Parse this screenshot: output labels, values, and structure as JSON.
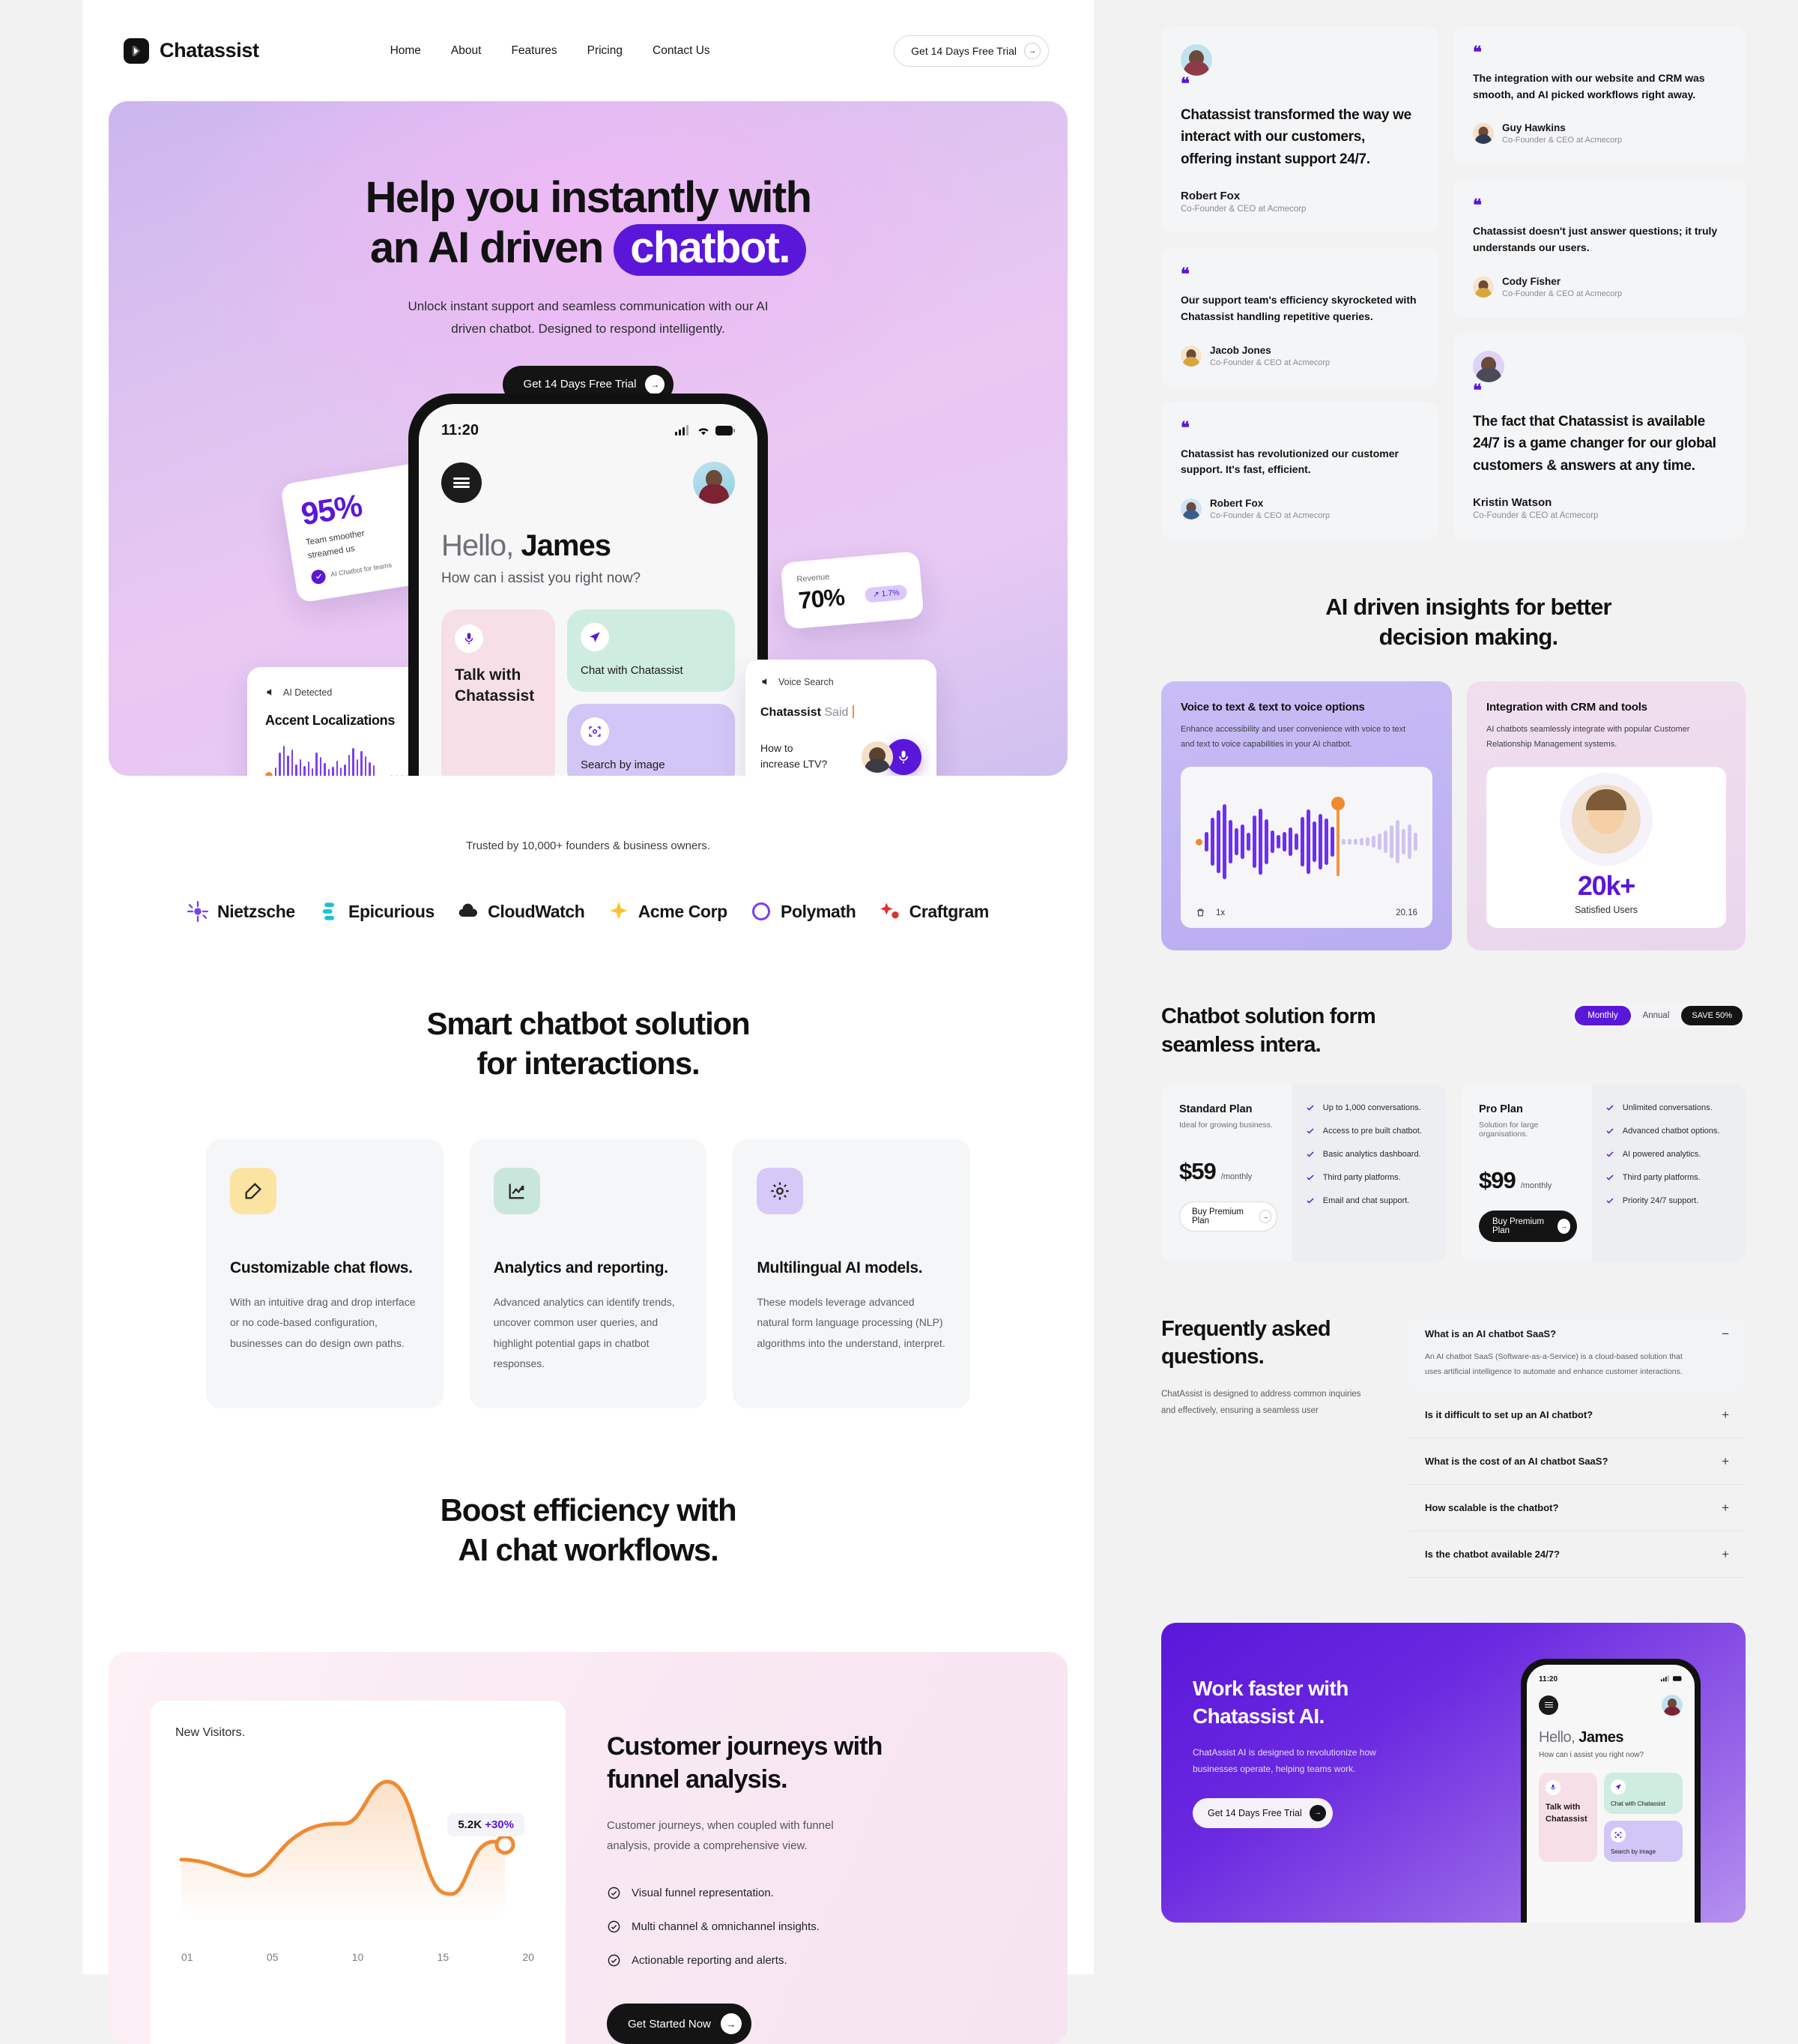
{
  "nav": {
    "brand": "Chatassist",
    "links": [
      "Home",
      "About",
      "Features",
      "Pricing",
      "Contact Us"
    ],
    "cta": "Get 14 Days Free Trial"
  },
  "hero": {
    "title_line1": "Help you instantly with",
    "title_line2_pre": "an AI driven",
    "title_highlight": "chatbot.",
    "subtitle_l1": "Unlock instant support and seamless communication with our AI",
    "subtitle_l2": "driven chatbot. Designed to respond intelligently.",
    "cta": "Get 14 Days Free Trial",
    "card_95": {
      "value": "95%",
      "desc_l1": "Team smoother",
      "desc_l2": "streamed us",
      "tiny": "AI Chatbot for teams"
    },
    "card_accent": {
      "chip": "AI Detected",
      "title": "Accent Localizations"
    },
    "card_revenue": {
      "label": "Revenue",
      "value": "70%",
      "badge": "1.7%"
    },
    "card_voice": {
      "chip": "Voice Search",
      "said_bold": "Chatassist",
      "said_rest": " Said",
      "question_l1": "How to",
      "question_l2": "increase LTV?"
    },
    "phone": {
      "time": "11:20",
      "greeting_pre": "Hello, ",
      "greeting_name": "James",
      "question": "How can i assist you right now?",
      "card_talk": "Talk with Chatassist",
      "card_chat": "Chat with Chatassist",
      "card_search": "Search by image"
    }
  },
  "trusted": {
    "text": "Trusted by 10,000+ founders & business owners.",
    "logos": [
      "Nietzsche",
      "Epicurious",
      "CloudWatch",
      "Acme Corp",
      "Polymath",
      "Craftgram"
    ]
  },
  "features": {
    "heading_l1": "Smart chatbot solution",
    "heading_l2": "for interactions.",
    "cards": [
      {
        "icon": "edit-icon",
        "title": "Customizable chat flows.",
        "body": "With an intuitive drag and drop interface or no code-based configuration, businesses can do design own paths."
      },
      {
        "icon": "chart-up-icon",
        "title": "Analytics and reporting.",
        "body": "Advanced analytics can identify trends, uncover common user queries, and highlight potential gaps in chatbot responses."
      },
      {
        "icon": "gear-icon",
        "title": "Multilingual AI models.",
        "body": "These models leverage advanced natural form language processing (NLP) algorithms into the understand, interpret."
      }
    ]
  },
  "funnel": {
    "heading_l1": "Boost efficiency with",
    "heading_l2": "AI chat workflows.",
    "title_l1": "Customer journeys with",
    "title_l2": "funnel analysis.",
    "lead_l1": "Customer journeys, when coupled with funnel",
    "lead_l2": "analysis, provide a comprehensive view.",
    "bullets": [
      "Visual funnel representation.",
      "Multi channel & omnichannel insights.",
      "Actionable reporting and alerts."
    ],
    "cta": "Get Started Now"
  },
  "chart_data": {
    "type": "area",
    "title": "New Visitors.",
    "xlabel": "",
    "ylabel": "",
    "x": [
      1,
      5,
      10,
      15,
      20
    ],
    "tick_labels": [
      "01",
      "05",
      "10",
      "15",
      "20"
    ],
    "values": [
      2.1,
      1.7,
      3.4,
      3.6,
      5.0,
      5.1,
      1.5,
      1.4,
      4.2,
      4.0
    ],
    "ylim": [
      0,
      6
    ],
    "grid": false,
    "annotation": {
      "value": "5.2K",
      "delta": "+30%"
    },
    "series_color": "#ef8a33"
  },
  "testimonials": {
    "col_a": [
      {
        "has_avatar": true,
        "quote": "Chatassist transformed the way we interact with our customers, offering instant support 24/7.",
        "name": "Robert Fox",
        "role": "Co-Founder & CEO at Acmecorp",
        "style": "large"
      },
      {
        "has_avatar": false,
        "quote": "Our support team's efficiency skyrocketed with Chatassist handling repetitive queries.",
        "name": "Jacob Jones",
        "role": "Co-Founder & CEO at Acmecorp",
        "style": "small"
      },
      {
        "has_avatar": false,
        "quote": "Chatassist has revolutionized our customer support. It's fast, efficient.",
        "name": "Robert Fox",
        "role": "Co-Founder & CEO at Acmecorp",
        "style": "small"
      }
    ],
    "col_b": [
      {
        "has_avatar": false,
        "quote": "The integration with our website and CRM was smooth, and AI picked workflows right away.",
        "name": "Guy Hawkins",
        "role": "Co-Founder & CEO at Acmecorp",
        "style": "small"
      },
      {
        "has_avatar": false,
        "quote": "Chatassist doesn't just answer questions; it truly understands our users.",
        "name": "Cody Fisher",
        "role": "Co-Founder & CEO at Acmecorp",
        "style": "small"
      },
      {
        "has_avatar": true,
        "quote": "The fact that Chatassist is available 24/7 is a game changer for our global customers & answers at any time.",
        "name": "Kristin Watson",
        "role": "Co-Founder & CEO at Acmecorp",
        "style": "large"
      }
    ]
  },
  "insights": {
    "heading_l1": "AI driven insights for better",
    "heading_l2": "decision making.",
    "voice": {
      "title": "Voice to text & text to voice options",
      "body_l1": "Enhance accessibility and user convenience with voice to text",
      "body_l2": "and text to voice capabilities in your AI chatbot.",
      "duration": "20.16",
      "speed": "1x"
    },
    "crm": {
      "title": "Integration with CRM and tools",
      "body_l1": "AI chatbots seamlessly integrate with popular Customer",
      "body_l2": "Relationship Management systems.",
      "stat": "20k+",
      "stat_label": "Satisfied Users"
    }
  },
  "pricing": {
    "heading_l1": "Chatbot solution form",
    "heading_l2": "seamless intera.",
    "toggle": {
      "monthly": "Monthly",
      "annual": "Annual",
      "save": "SAVE 50%"
    },
    "plans": [
      {
        "name": "Standard Plan",
        "sub": "Ideal for growing business.",
        "price": "$59",
        "period": "/monthly",
        "button": "Buy Premium Plan",
        "features": [
          "Up to 1,000 conversations.",
          "Access to pre built chatbot.",
          "Basic analytics dashboard.",
          "Third party platforms.",
          "Email and chat support."
        ]
      },
      {
        "name": "Pro Plan",
        "sub": "Solution for large organisations.",
        "price": "$99",
        "period": "/monthly",
        "button": "Buy Premium Plan",
        "features": [
          "Unlimited conversations.",
          "Advanced chatbot options.",
          "AI powered analytics.",
          "Third party platforms.",
          "Priority 24/7 support."
        ]
      }
    ]
  },
  "faq": {
    "heading_l1": "Frequently asked",
    "heading_l2": "questions.",
    "lead_l1": "ChatAssist is designed to address common inquiries",
    "lead_l2": "and effectively, ensuring a seamless user",
    "items": [
      {
        "q": "What is an AI chatbot SaaS?",
        "sign": "−",
        "open": true,
        "a_l1": "An AI chatbot SaaS (Software-as-a-Service) is a cloud-based solution that",
        "a_l2": "uses artificial intelligence to automate and enhance customer interactions."
      },
      {
        "q": "Is it difficult to set up an AI chatbot?",
        "sign": "+",
        "open": false
      },
      {
        "q": "What is the cost of an AI chatbot SaaS?",
        "sign": "+",
        "open": false
      },
      {
        "q": "How scalable is the chatbot?",
        "sign": "+",
        "open": false
      },
      {
        "q": "Is the chatbot available 24/7?",
        "sign": "+",
        "open": false
      }
    ]
  },
  "cta": {
    "heading_l1": "Work faster with",
    "heading_l2": "Chatassist AI.",
    "body_l1": "ChatAssist AI is designed to revolutionize how",
    "body_l2": "businesses operate, helping teams work.",
    "button": "Get 14 Days Free Trial",
    "phone": {
      "time": "11:20",
      "greeting_pre": "Hello, ",
      "greeting_name": "James",
      "question": "How can i assist you right now?",
      "card_talk": "Talk with Chatassist",
      "card_chat": "Chat with Chatassist",
      "card_search": "Search by image"
    }
  },
  "colors": {
    "brand_purple": "#5b17d9",
    "accent_orange": "#ef8a33",
    "dark": "#141414"
  }
}
